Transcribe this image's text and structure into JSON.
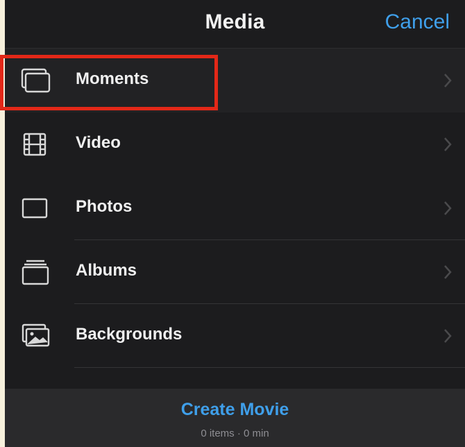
{
  "navbar": {
    "title": "Media",
    "cancel_label": "Cancel"
  },
  "items": [
    {
      "label": "Moments",
      "icon": "moments-icon"
    },
    {
      "label": "Video",
      "icon": "film-icon"
    },
    {
      "label": "Photos",
      "icon": "photo-frame-icon"
    },
    {
      "label": "Albums",
      "icon": "albums-icon"
    },
    {
      "label": "Backgrounds",
      "icon": "backgrounds-icon"
    }
  ],
  "footer": {
    "create_label": "Create Movie",
    "meta": "0 items · 0 min"
  },
  "colors": {
    "accent": "#3f9fea",
    "background": "#1c1c1e",
    "highlight": "#e32818"
  }
}
